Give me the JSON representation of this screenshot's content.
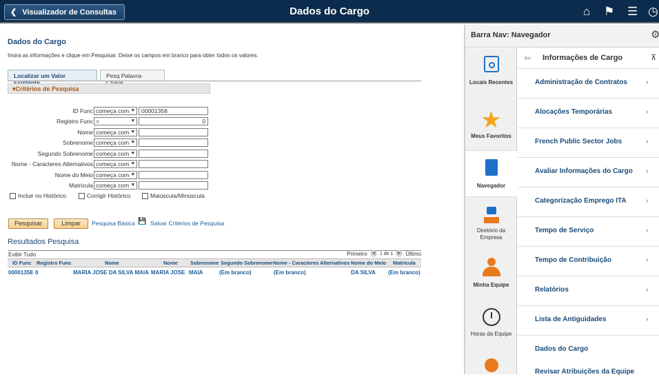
{
  "header": {
    "back_label": "Visualizador de Consultas",
    "title": "Dados do Cargo"
  },
  "page": {
    "heading": "Dados do Cargo",
    "instructions": "Insira as informações e clique em Pesquisar. Deixe os campos em branco para obter todos os valores.",
    "tabs": [
      "Localizar um Valor Existente",
      "Pesq Palavra-Chave"
    ],
    "criteria_title": "Critérios de Pesquisa",
    "fields": [
      {
        "label": "ID Func",
        "op": "começa com",
        "value": "00001358"
      },
      {
        "label": "Registro Func",
        "op": "=",
        "value": "0"
      },
      {
        "label": "Nome",
        "op": "começa com",
        "value": ""
      },
      {
        "label": "Sobrenome",
        "op": "começa com",
        "value": ""
      },
      {
        "label": "Segundo Sobrenome",
        "op": "começa com",
        "value": ""
      },
      {
        "label": "Nome - Caracteres Alternativos",
        "op": "começa com",
        "value": ""
      },
      {
        "label": "Nome do Meio",
        "op": "começa com",
        "value": ""
      },
      {
        "label": "Matrícula",
        "op": "começa com",
        "value": ""
      }
    ],
    "checkboxes": [
      "Incluir no Histórico",
      "Corrigir Histórico",
      "Maiúscula/Minúscula"
    ],
    "buttons": {
      "search": "Pesquisar",
      "clear": "Limpar"
    },
    "links": {
      "basic": "Pesquisa Básica",
      "save": "Salvar Critérios de Pesquisa"
    },
    "results_title": "Resultados Pesquisa",
    "show_all": "Exibir Tudo",
    "pager": {
      "first": "Primeiro",
      "range": "1 de 1",
      "last": "Último"
    },
    "columns": [
      "ID Func",
      "Registro Func",
      "Nome",
      "Nome",
      "Sobrenome",
      "Segundo Sobrenome",
      "Nome - Caracteres Alternativos",
      "Nome do Meio",
      "Matrícula"
    ],
    "rows": [
      [
        "00001358",
        "0",
        "MARIA JOSE DA SILVA MAIA",
        "MARIA JOSE",
        "MAIA",
        "(Em branco)",
        "(Em branco)",
        "DA SILVA",
        "(Em branco)"
      ]
    ]
  },
  "nav": {
    "title": "Barra Nav: Navegador",
    "rail": [
      "Locais Recentes",
      "Meus Favoritos",
      "Navegador",
      "Diretório da Empresa",
      "Minha Equipe",
      "Horas da Equipe"
    ],
    "panel_title": "Informações de Cargo",
    "items": [
      "Administração de Contratos",
      "Alocações Temporárias",
      "French Public Sector Jobs",
      "Avaliar Informações do Cargo",
      "Categorização Emprego ITA",
      "Tempo de Serviço",
      "Tempo de Contribuição",
      "Relatórios",
      "Lista de Antiguidades",
      "Dados do Cargo",
      "Revisar Atribuições da Equipe"
    ]
  },
  "colors": {
    "header_bg": "#0c2c4d",
    "link": "#1c5c9a",
    "button": "#f7cf8a"
  }
}
